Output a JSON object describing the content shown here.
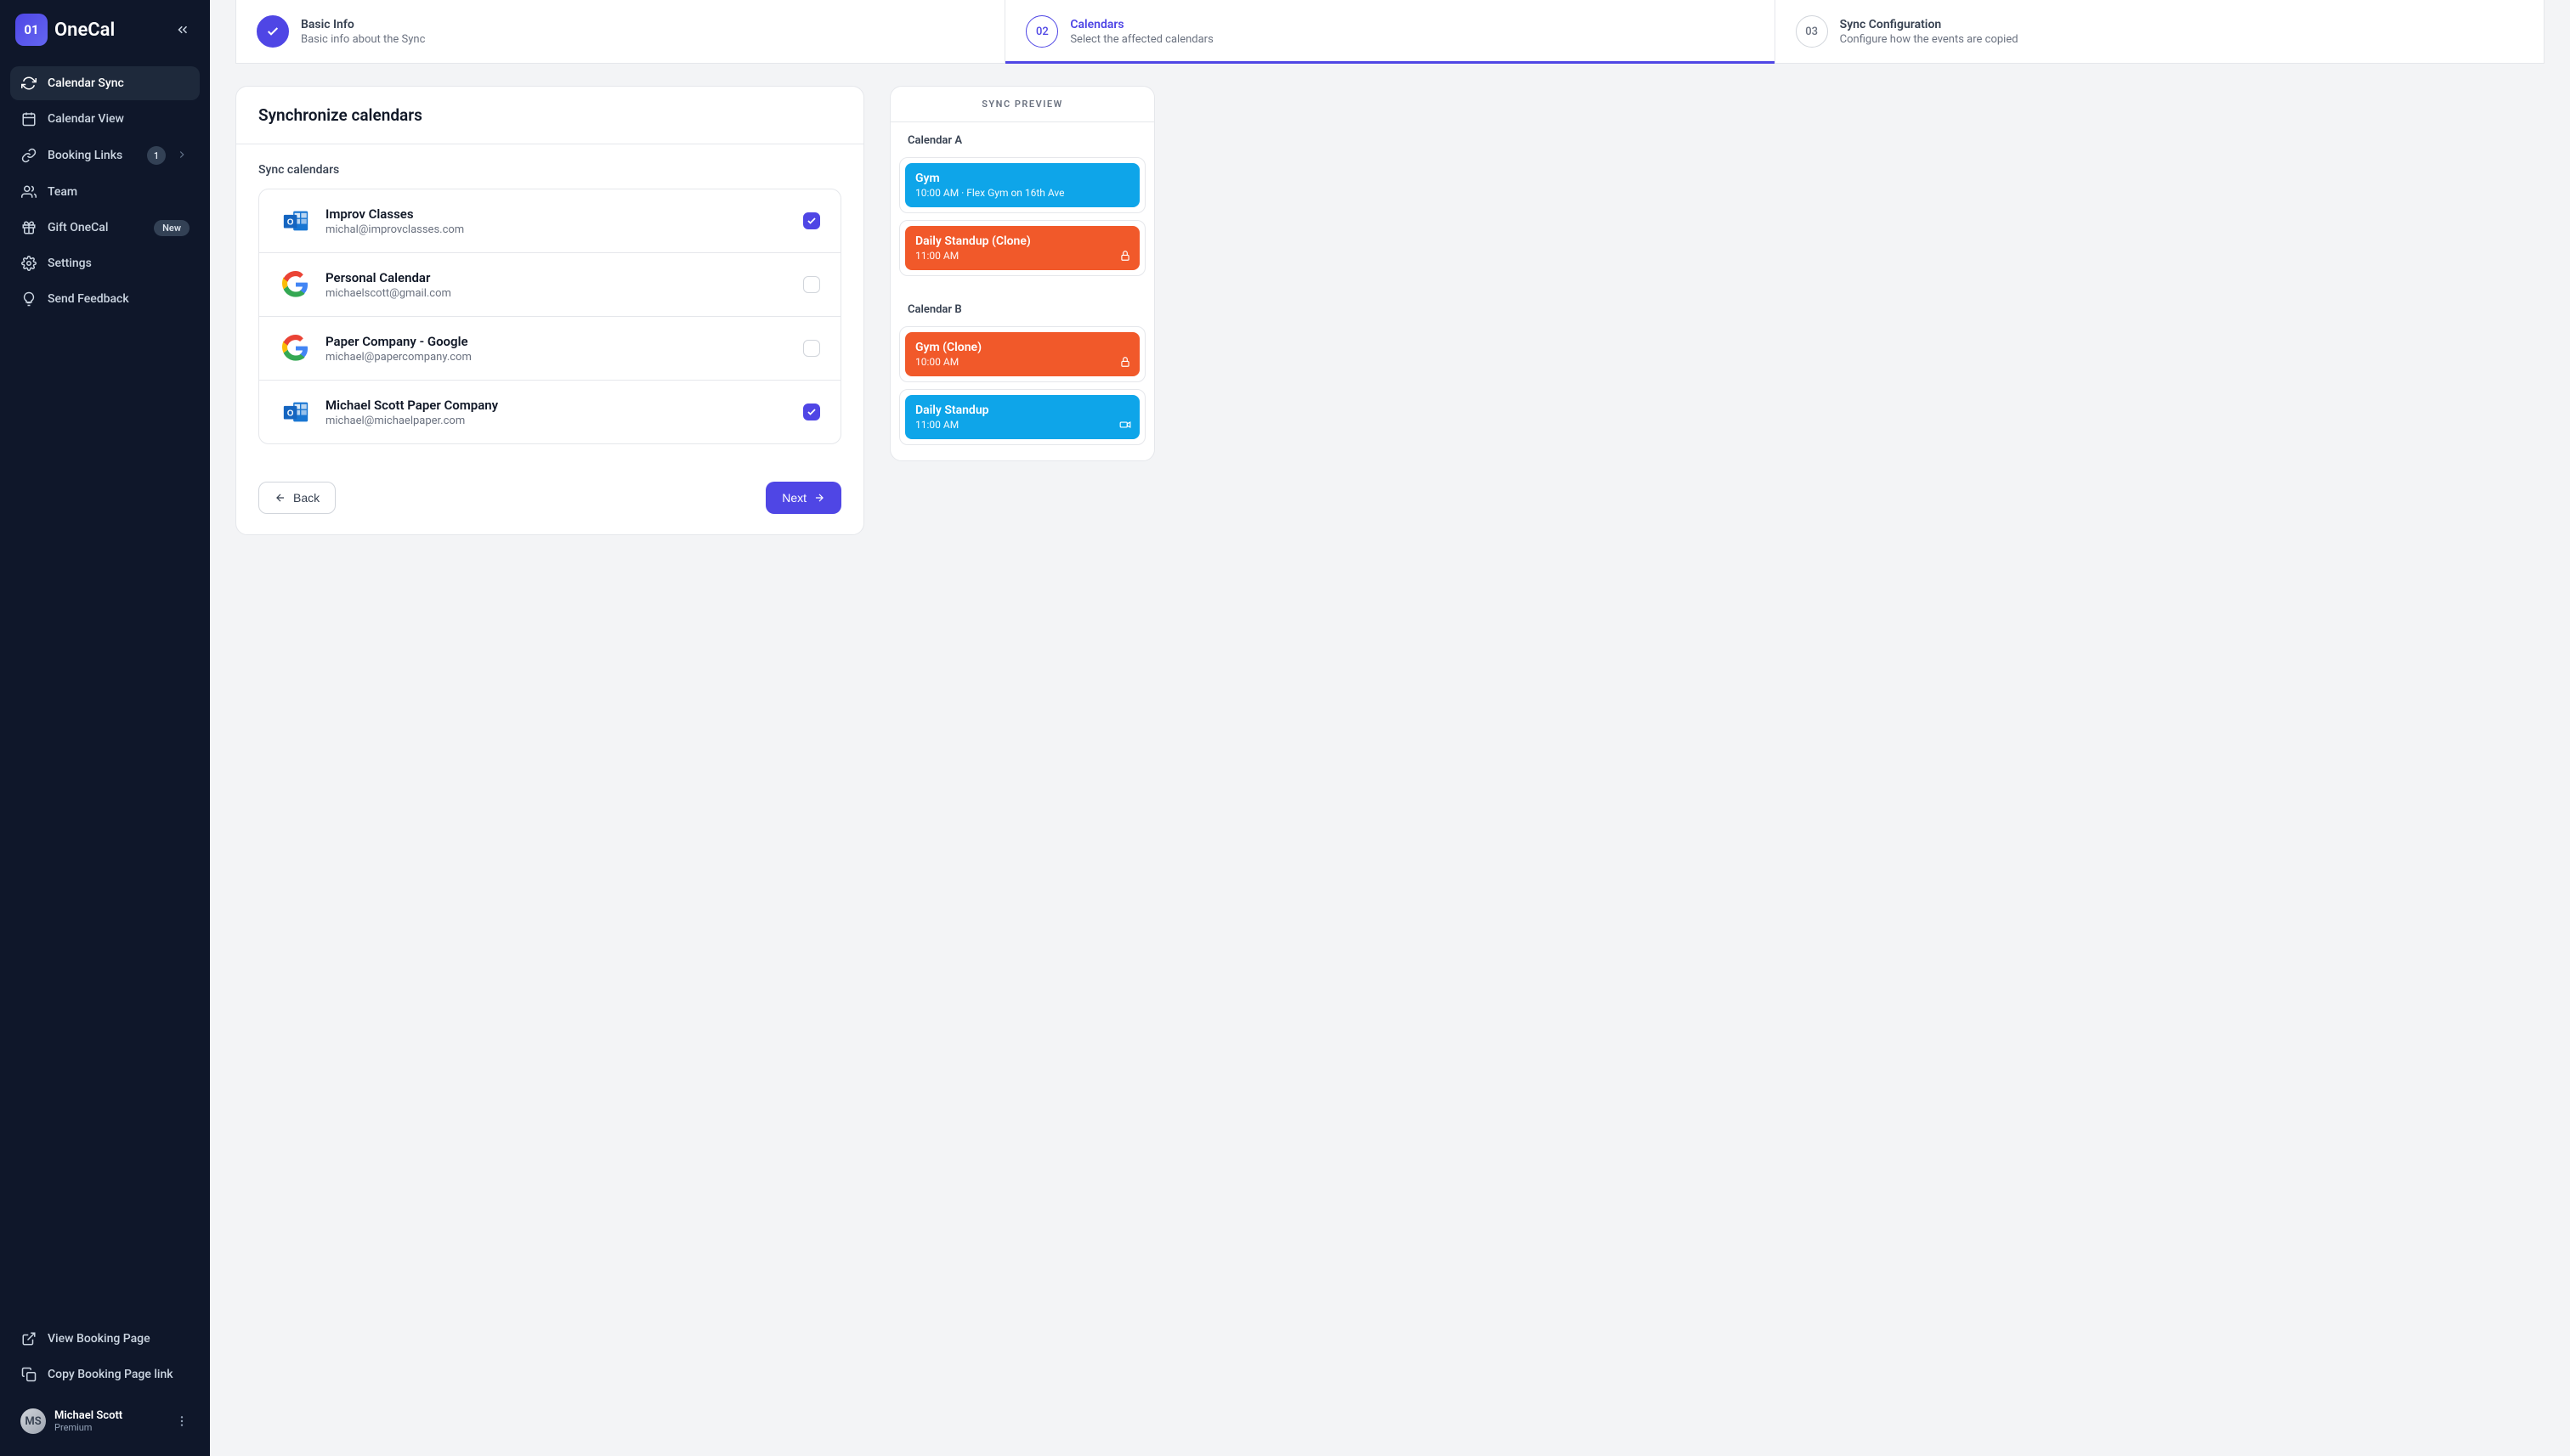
{
  "brand": {
    "mark": "01",
    "name": "OneCal"
  },
  "sidebar": {
    "items": [
      {
        "label": "Calendar Sync",
        "icon": "sync"
      },
      {
        "label": "Calendar View",
        "icon": "calendar"
      },
      {
        "label": "Booking Links",
        "icon": "link",
        "count": "1",
        "chevron": true
      },
      {
        "label": "Team",
        "icon": "team"
      },
      {
        "label": "Gift OneCal",
        "icon": "gift",
        "badge": "New"
      },
      {
        "label": "Settings",
        "icon": "gear"
      },
      {
        "label": "Send Feedback",
        "icon": "bulb"
      }
    ],
    "footer": [
      {
        "label": "View Booking Page",
        "icon": "external"
      },
      {
        "label": "Copy Booking Page link",
        "icon": "copy"
      }
    ],
    "profile": {
      "name": "Michael Scott",
      "plan": "Premium",
      "initials": "MS"
    }
  },
  "stepper": {
    "steps": [
      {
        "num": "✓",
        "title": "Basic Info",
        "sub": "Basic info about the Sync",
        "state": "done"
      },
      {
        "num": "02",
        "title": "Calendars",
        "sub": "Select the affected calendars",
        "state": "active"
      },
      {
        "num": "03",
        "title": "Sync Configuration",
        "sub": "Configure how the events are copied",
        "state": "idle"
      }
    ]
  },
  "page": {
    "title": "Synchronize calendars",
    "section": "Sync calendars",
    "back": "Back",
    "next": "Next"
  },
  "calendars": [
    {
      "name": "Improv Classes",
      "email": "michal@improvclasses.com",
      "provider": "outlook",
      "checked": true
    },
    {
      "name": "Personal Calendar",
      "email": "michaelscott@gmail.com",
      "provider": "google",
      "checked": false
    },
    {
      "name": "Paper Company - Google",
      "email": "michael@papercompany.com",
      "provider": "google",
      "checked": false
    },
    {
      "name": "Michael Scott Paper Company",
      "email": "michael@michaelpaper.com",
      "provider": "outlook",
      "checked": true
    }
  ],
  "preview": {
    "header": "SYNC PREVIEW",
    "groups": [
      {
        "label": "Calendar A",
        "events": [
          {
            "title": "Gym",
            "meta": "10:00 AM · Flex Gym on 16th Ave",
            "color": "blue",
            "icon": null
          },
          {
            "title": "Daily Standup (Clone)",
            "meta": "11:00 AM",
            "color": "orange",
            "icon": "lock"
          }
        ]
      },
      {
        "label": "Calendar B",
        "events": [
          {
            "title": "Gym (Clone)",
            "meta": "10:00 AM",
            "color": "orange",
            "icon": "lock"
          },
          {
            "title": "Daily Standup",
            "meta": "11:00 AM",
            "color": "blue",
            "icon": "video"
          }
        ]
      }
    ]
  }
}
